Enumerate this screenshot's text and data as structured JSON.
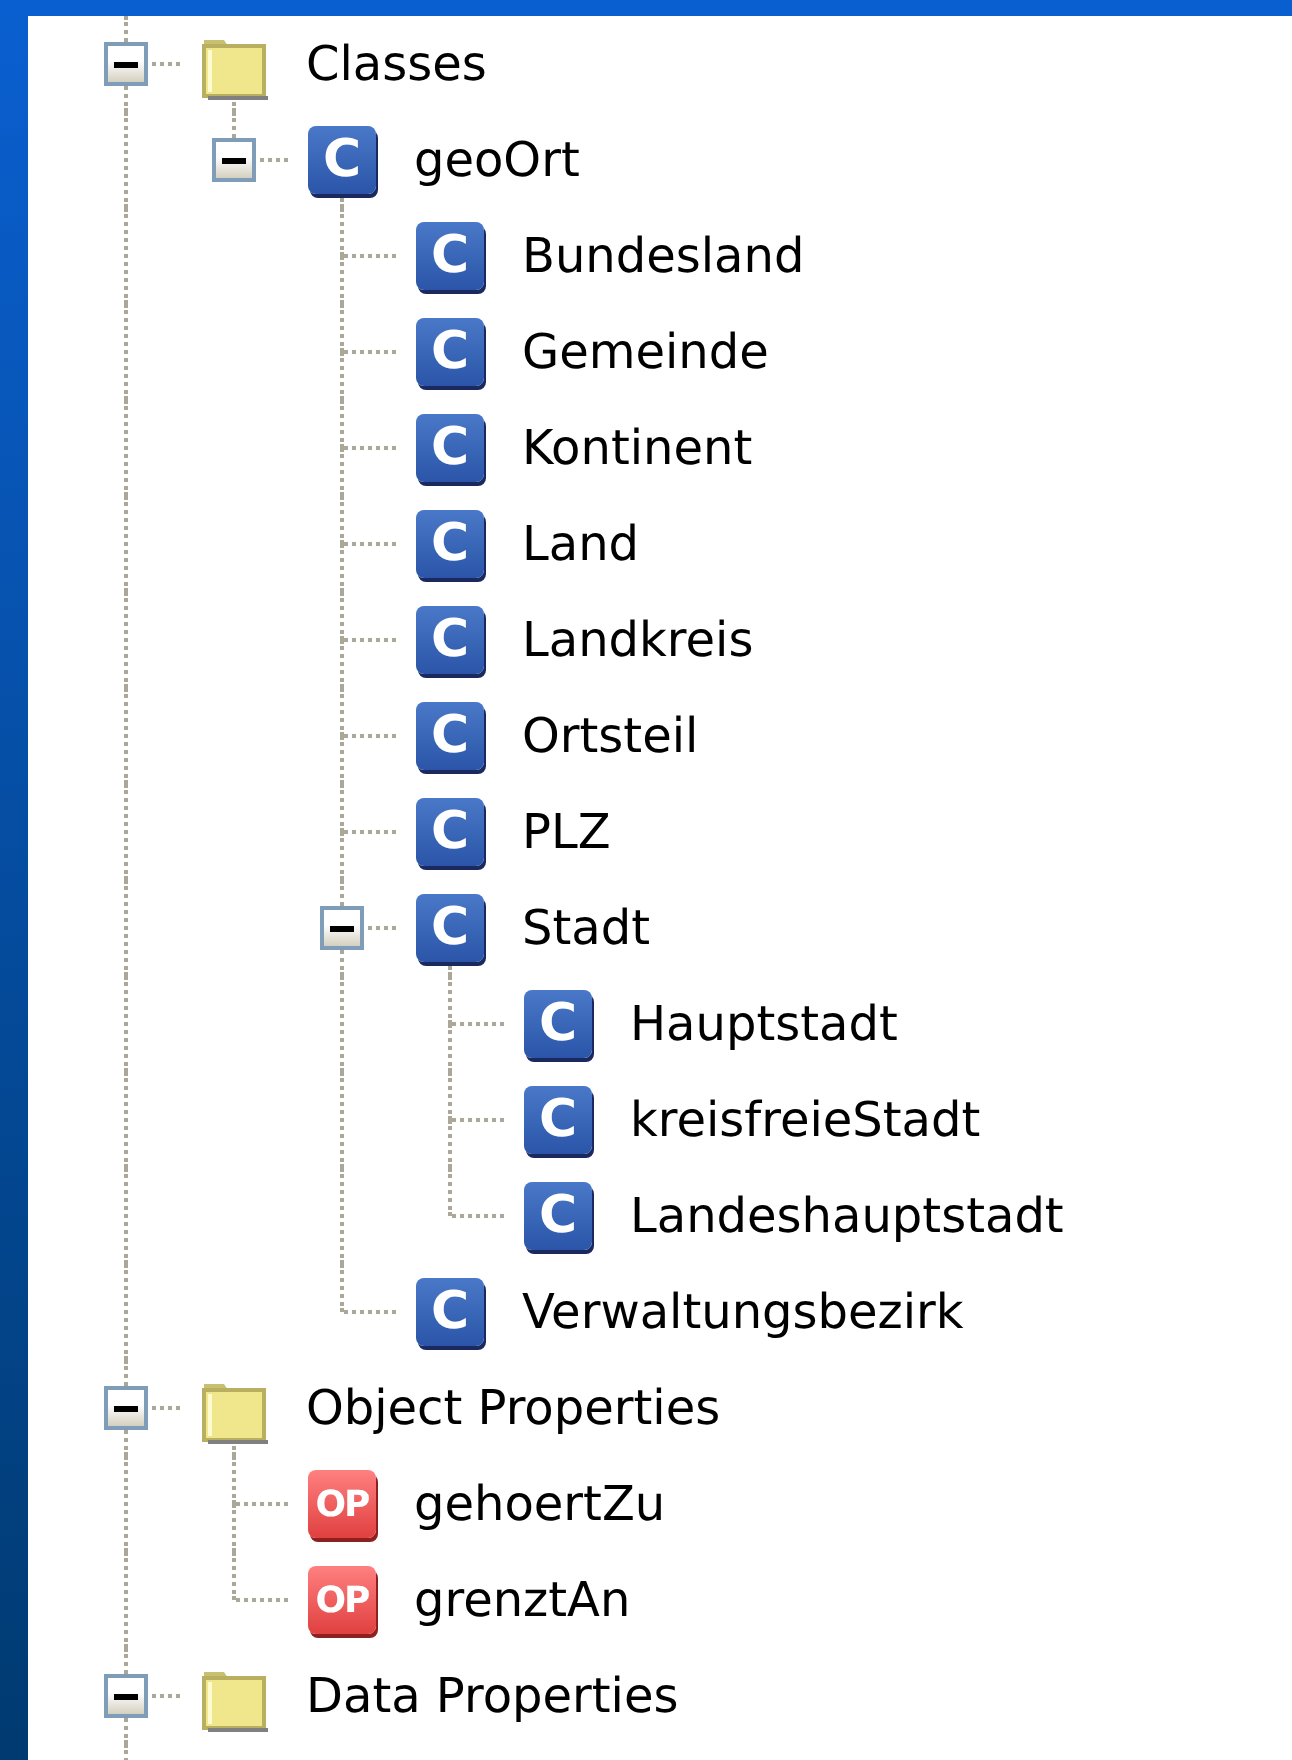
{
  "tree": [
    {
      "label": "Classes",
      "kind": "folder",
      "expanded": true,
      "children": [
        {
          "label": "geoOrt",
          "kind": "class",
          "icon_text": "C",
          "expanded": true,
          "children": [
            {
              "label": "Bundesland",
              "kind": "class",
              "icon_text": "C"
            },
            {
              "label": "Gemeinde",
              "kind": "class",
              "icon_text": "C"
            },
            {
              "label": "Kontinent",
              "kind": "class",
              "icon_text": "C"
            },
            {
              "label": "Land",
              "kind": "class",
              "icon_text": "C"
            },
            {
              "label": "Landkreis",
              "kind": "class",
              "icon_text": "C"
            },
            {
              "label": "Ortsteil",
              "kind": "class",
              "icon_text": "C"
            },
            {
              "label": "PLZ",
              "kind": "class",
              "icon_text": "C"
            },
            {
              "label": "Stadt",
              "kind": "class",
              "icon_text": "C",
              "expanded": true,
              "children": [
                {
                  "label": "Hauptstadt",
                  "kind": "class",
                  "icon_text": "C"
                },
                {
                  "label": "kreisfreieStadt",
                  "kind": "class",
                  "icon_text": "C"
                },
                {
                  "label": "Landeshauptstadt",
                  "kind": "class",
                  "icon_text": "C"
                }
              ]
            },
            {
              "label": "Verwaltungsbezirk",
              "kind": "class",
              "icon_text": "C"
            }
          ]
        }
      ]
    },
    {
      "label": "Object Properties",
      "kind": "folder",
      "expanded": true,
      "children": [
        {
          "label": "gehoertZu",
          "kind": "object-property",
          "icon_text": "OP"
        },
        {
          "label": "grenztAn",
          "kind": "object-property",
          "icon_text": "OP"
        }
      ]
    },
    {
      "label": "Data Properties",
      "kind": "folder",
      "expanded": true
    }
  ]
}
